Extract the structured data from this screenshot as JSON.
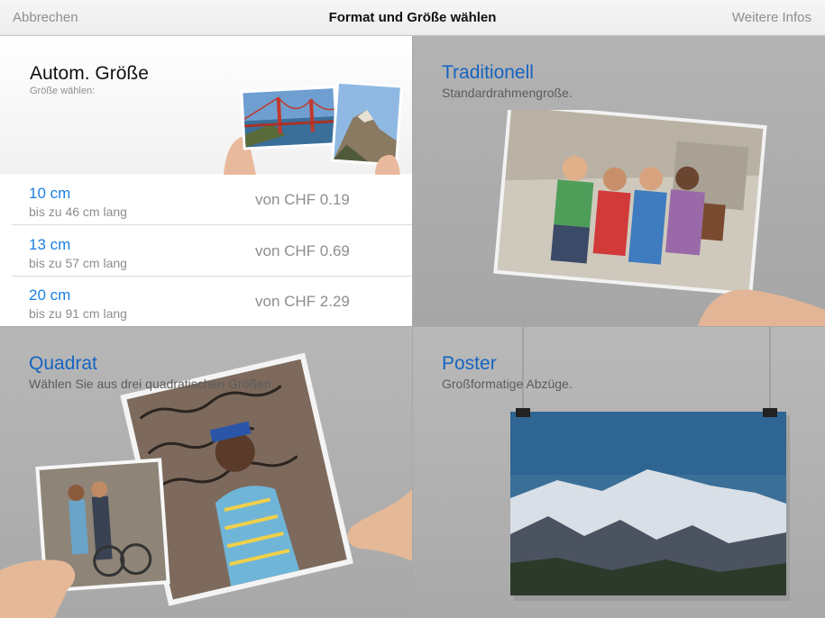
{
  "navbar": {
    "cancel_label": "Abbrechen",
    "title": "Format und Größe wählen",
    "info_label": "Weitere Infos"
  },
  "auto": {
    "title": "Autom. Größe",
    "subtitle": "Größe wählen:",
    "sizes": [
      {
        "size": "10 cm",
        "length": "bis zu 46 cm lang",
        "price": "von CHF 0.19"
      },
      {
        "size": "13 cm",
        "length": "bis zu 57 cm lang",
        "price": "von CHF 0.69"
      },
      {
        "size": "20 cm",
        "length": "bis zu 91 cm lang",
        "price": "von CHF 2.29"
      }
    ]
  },
  "traditionell": {
    "title": "Traditionell",
    "subtitle": "Standardrahmengroße."
  },
  "quadrat": {
    "title": "Quadrat",
    "subtitle": "Wählen Sie aus drei quadratischen Größen."
  },
  "poster": {
    "title": "Poster",
    "subtitle": "Großformatige Abzüge."
  },
  "colors": {
    "accent_blue": "#1b7fe0",
    "title_blue": "#1764c0",
    "nav_gray": "#8e8e93"
  }
}
